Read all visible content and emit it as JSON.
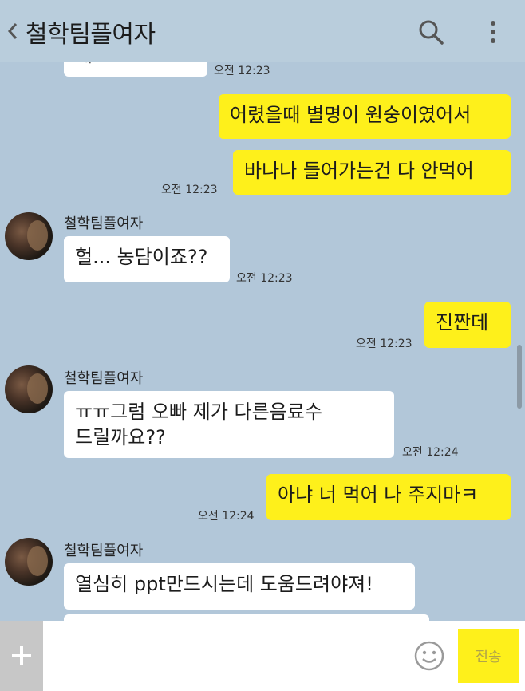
{
  "header": {
    "title": "철학팀플여자",
    "back_icon": "chevron-left-icon",
    "search_icon": "search-icon",
    "menu_icon": "more-vertical-icon"
  },
  "messages": [
    {
      "side": "right",
      "text": "어렸을때 별명이 원숭이였어서",
      "time": ""
    },
    {
      "side": "right",
      "text": "바나나 들어가는건 다 안먹어",
      "time": "오전 12:23"
    },
    {
      "side": "left",
      "sender": "철학팀플여자",
      "text": "헐... 농담이죠??",
      "time": "오전 12:23"
    },
    {
      "side": "right",
      "text": "진짠데",
      "time": "오전 12:23"
    },
    {
      "side": "left",
      "sender": "철학팀플여자",
      "lines": [
        "ㅠㅠ그럼 오빠 제가 다른음료수",
        "드릴까요??"
      ],
      "time": "오전 12:24"
    },
    {
      "side": "right",
      "text": "아냐 너 먹어 나 주지마ㅋ",
      "time": "오전 12:24"
    },
    {
      "side": "left",
      "sender": "철학팀플여자",
      "text": "열심히 ppt만드시는데 도움드려야져!",
      "time": ""
    }
  ],
  "top_partial": {
    "text": "제요???ㅠㅠ",
    "time": "오전 12:23"
  },
  "input_bar": {
    "placeholder": "",
    "send_label": "전송",
    "plus_icon": "plus-icon",
    "emoji_icon": "emoji-icon"
  },
  "colors": {
    "background": "#b2c7d9",
    "my_bubble": "#fef01b",
    "their_bubble": "#ffffff"
  }
}
